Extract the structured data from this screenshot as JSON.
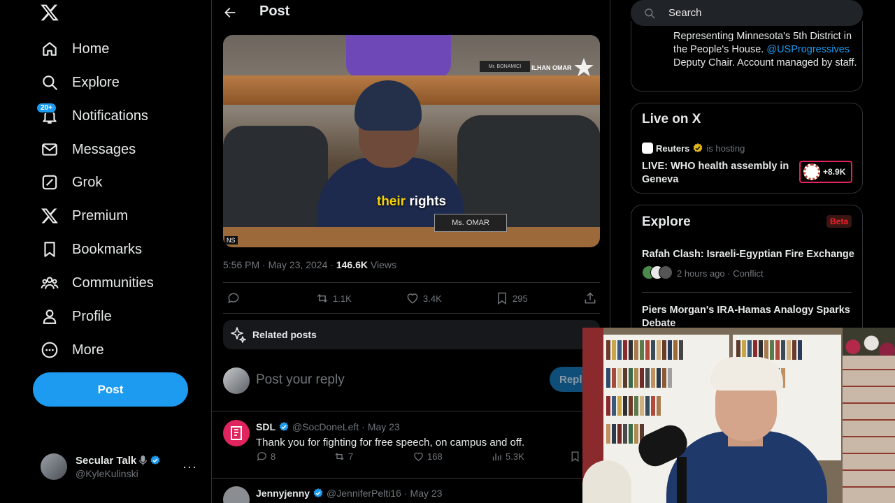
{
  "nav": {
    "items": [
      {
        "label": "Home",
        "icon": "home-icon"
      },
      {
        "label": "Explore",
        "icon": "search-icon"
      },
      {
        "label": "Notifications",
        "icon": "bell-icon",
        "badge": "20+"
      },
      {
        "label": "Messages",
        "icon": "mail-icon"
      },
      {
        "label": "Grok",
        "icon": "grok-icon"
      },
      {
        "label": "Premium",
        "icon": "x-icon"
      },
      {
        "label": "Bookmarks",
        "icon": "bookmark-icon"
      },
      {
        "label": "Communities",
        "icon": "communities-icon"
      },
      {
        "label": "Profile",
        "icon": "person-icon"
      },
      {
        "label": "More",
        "icon": "more-circle-icon"
      }
    ],
    "post_label": "Post",
    "account": {
      "name": "Secular Talk",
      "handle": "@KyleKulinski"
    }
  },
  "post": {
    "header_title": "Post",
    "video": {
      "caption_highlight": "their",
      "caption_rest": " rights",
      "nameplate": "Ms. OMAR",
      "nameplate_back": "Mr. BONAMICI",
      "watermark": "ILHAN OMAR",
      "corner_text": "NS"
    },
    "time": "5:56 PM · May 23, 2024 · ",
    "views_count": "146.6K",
    "views_label": " Views",
    "actions": {
      "retweets": "1.1K",
      "likes": "3.4K",
      "bookmarks": "295"
    },
    "related_label": "Related posts",
    "reply_placeholder": "Post your reply",
    "reply_button": "Reply"
  },
  "comments": [
    {
      "name": "SDL",
      "handle": "@SocDoneLeft",
      "time": "May 23",
      "text": "Thank you for fighting for free speech, on campus and off.",
      "replies": "8",
      "retweets": "7",
      "likes": "168",
      "views": "5.3K"
    },
    {
      "name": "Jennyjenny",
      "handle": "@JenniferPelti16",
      "time": "May 23"
    }
  ],
  "sidebar": {
    "search_placeholder": "Search",
    "bio_line1": "Representing Minnesota's 5th District in the People's House.",
    "bio_link": "@USProgressives",
    "bio_line2": " Deputy Chair. Account managed by staff.",
    "live": {
      "title": "Live on X",
      "host": "Reuters",
      "hosting_label": "is hosting",
      "headline": "LIVE: WHO health assembly in Geneva",
      "count": "+8.9K"
    },
    "explore": {
      "title": "Explore",
      "badge": "Beta",
      "trend1": "Rafah Clash: Israeli-Egyptian Fire Exchange",
      "trend1_meta": "2 hours ago · Conflict",
      "trend2": "Piers Morgan's IRA-Hamas Analogy Sparks Debate"
    }
  },
  "colors": {
    "accent": "#1d9bf0",
    "background": "#000000",
    "border": "#2f3336",
    "muted": "#71767b",
    "live_red": "#e0245e"
  }
}
